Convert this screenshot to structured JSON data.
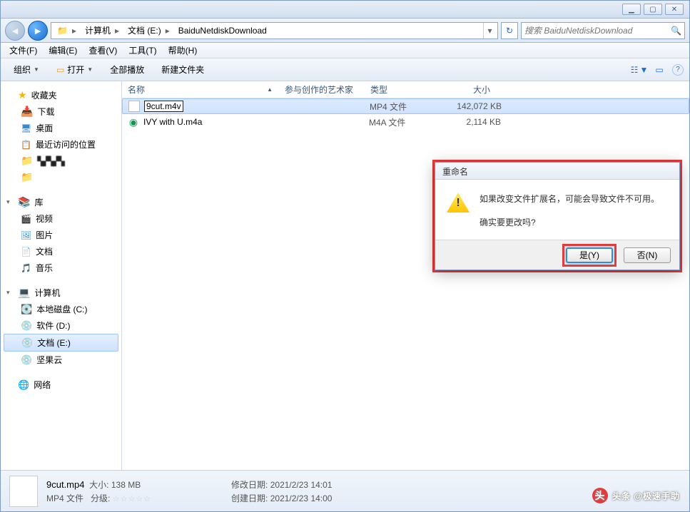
{
  "window_buttons": {
    "min": "▁",
    "max": "▢",
    "close": "✕"
  },
  "breadcrumb": {
    "icon": "💻",
    "items": [
      "计算机",
      "文档 (E:)",
      "BaiduNetdiskDownload"
    ]
  },
  "search": {
    "placeholder": "搜索 BaiduNetdiskDownload",
    "icon": "🔍"
  },
  "refresh_icon": "↻",
  "menu": [
    "文件(F)",
    "编辑(E)",
    "查看(V)",
    "工具(T)",
    "帮助(H)"
  ],
  "toolbar": {
    "organize": "组织",
    "open": "打开",
    "play_all": "全部播放",
    "new_folder": "新建文件夹",
    "view_icon": "☷",
    "preview_icon": "▭",
    "help_icon": "?"
  },
  "sidebar": {
    "favorites": {
      "label": "收藏夹",
      "items": [
        "下载",
        "桌面",
        "最近访问的位置"
      ],
      "obscured": [
        "▚▞▚▞▚",
        ""
      ]
    },
    "libraries": {
      "label": "库",
      "items": [
        "视频",
        "图片",
        "文档",
        "音乐"
      ]
    },
    "computer": {
      "label": "计算机",
      "items": [
        "本地磁盘 (C:)",
        "软件 (D:)",
        "文档 (E:)",
        "坚果云"
      ]
    },
    "network": {
      "label": "网络"
    }
  },
  "columns": {
    "name": "名称",
    "artist": "参与创作的艺术家",
    "type": "类型",
    "size": "大小"
  },
  "files": [
    {
      "name": "9cut.m4v",
      "type": "MP4 文件",
      "size": "142,072 KB",
      "selected": true,
      "renaming": true,
      "icon": "doc"
    },
    {
      "name": "IVY with U.m4a",
      "type": "M4A 文件",
      "size": "2,114 KB",
      "icon": "m4a"
    }
  ],
  "status": {
    "name": "9cut.mp4",
    "size_label": "大小:",
    "size": "138 MB",
    "type": "MP4 文件",
    "rating_label": "分级:",
    "mod_label": "修改日期:",
    "mod": "2021/2/23 14:01",
    "create_label": "创建日期:",
    "create": "2021/2/23 14:00"
  },
  "dialog": {
    "title": "重命名",
    "msg1": "如果改变文件扩展名，可能会导致文件不可用。",
    "msg2": "确实要更改吗?",
    "yes": "是(Y)",
    "no": "否(N)"
  },
  "watermark": "头条 @极速手助"
}
